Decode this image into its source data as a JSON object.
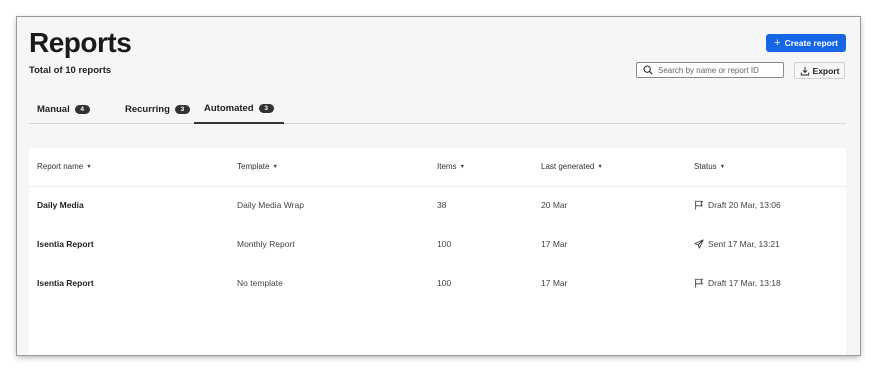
{
  "header": {
    "title": "Reports",
    "subtitle": "Total of 10 reports",
    "create_label": "Create report",
    "search_placeholder": "Search by name or report ID",
    "export_label": "Export"
  },
  "tabs": [
    {
      "label": "Manual",
      "count": "4",
      "active": false
    },
    {
      "label": "Recurring",
      "count": "3",
      "active": false
    },
    {
      "label": "Automated",
      "count": "3",
      "active": true
    }
  ],
  "table": {
    "columns": [
      "Report name",
      "Template",
      "Items",
      "Last generated",
      "Status"
    ],
    "rows": [
      {
        "name": "Daily Media",
        "template": "Daily Media Wrap",
        "items": "38",
        "last_generated": "20 Mar",
        "status_icon": "flag-icon",
        "status": "Draft 20 Mar, 13:06"
      },
      {
        "name": "Isentia Report",
        "template": "Monthly Report",
        "items": "100",
        "last_generated": "17 Mar",
        "status_icon": "send-icon",
        "status": "Sent 17 Mar, 13:21"
      },
      {
        "name": "Isentia Report",
        "template": "No template",
        "items": "100",
        "last_generated": "17 Mar",
        "status_icon": "flag-icon",
        "status": "Draft 17 Mar, 13:18"
      }
    ]
  },
  "colors": {
    "accent": "#1565e6",
    "page_background": "#f6f6f6",
    "badge": "#333333"
  }
}
